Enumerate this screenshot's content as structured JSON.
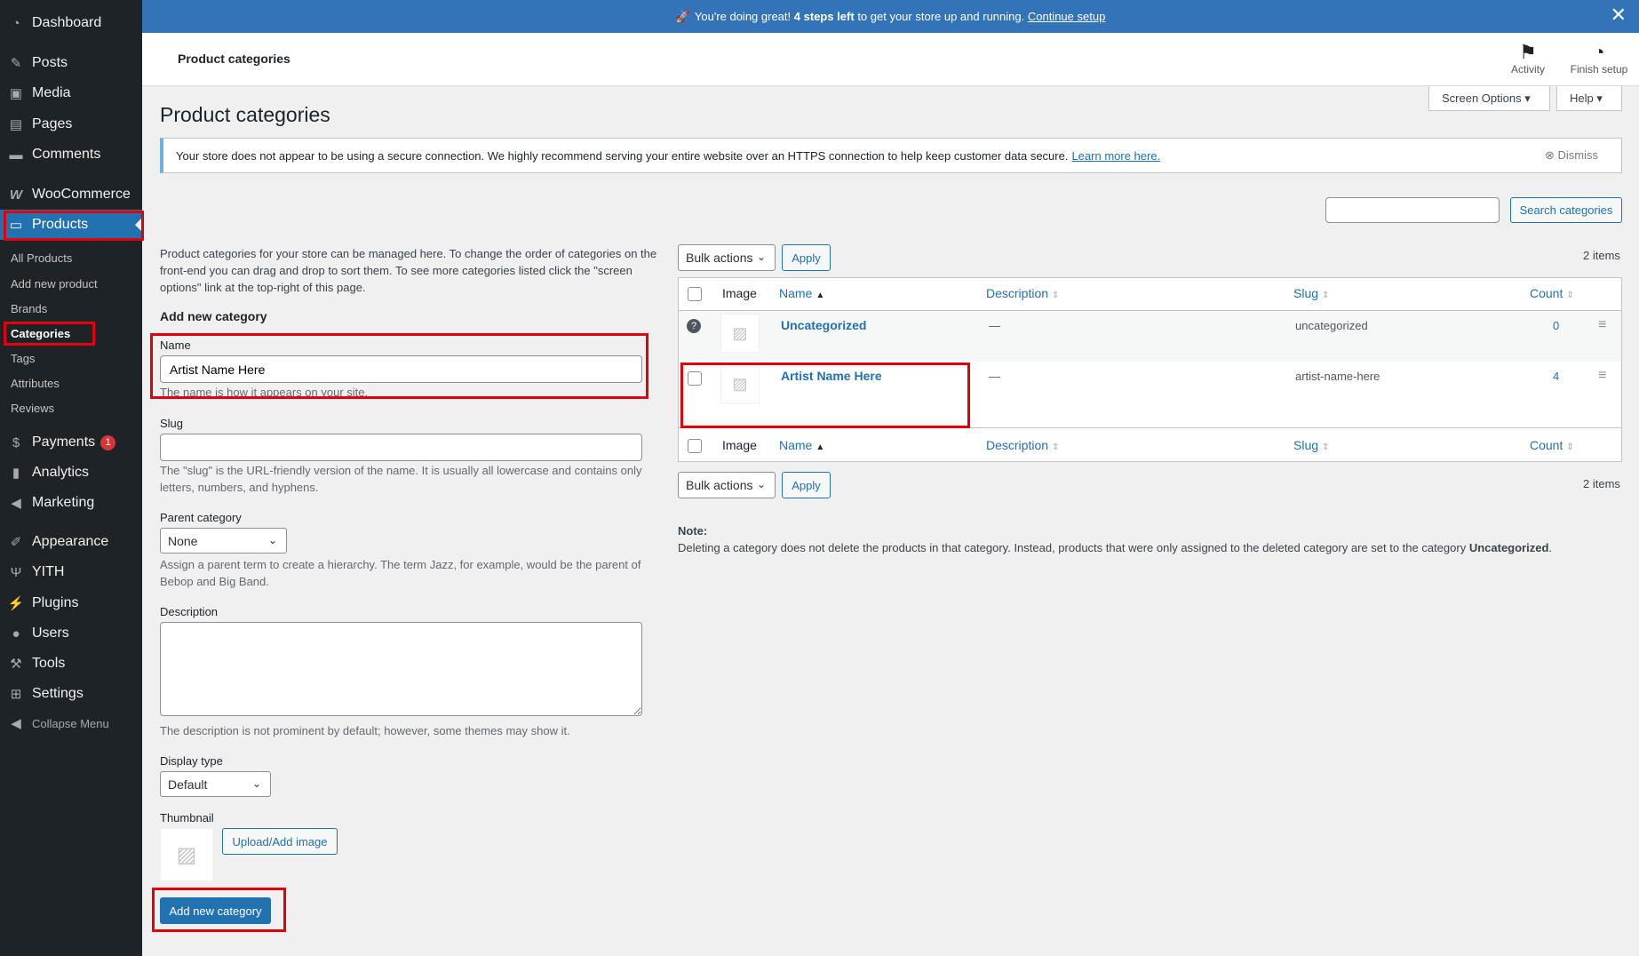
{
  "sidebar": {
    "dashboard": "Dashboard",
    "posts": "Posts",
    "media": "Media",
    "pages": "Pages",
    "comments": "Comments",
    "woocommerce": "WooCommerce",
    "products": "Products",
    "submenu": [
      "All Products",
      "Add new product",
      "Brands",
      "Categories",
      "Tags",
      "Attributes",
      "Reviews"
    ],
    "payments": "Payments",
    "payments_badge": "1",
    "analytics": "Analytics",
    "marketing": "Marketing",
    "appearance": "Appearance",
    "yith": "YITH",
    "plugins": "Plugins",
    "users": "Users",
    "tools": "Tools",
    "settings": "Settings",
    "collapse": "Collapse Menu"
  },
  "banner": {
    "emoji": "🚀",
    "text_start": "You're doing great!",
    "bold": "4 steps left",
    "text_end": "to get your store up and running.",
    "link": "Continue setup"
  },
  "header": {
    "title": "Product categories",
    "activity": "Activity",
    "finish_setup": "Finish setup"
  },
  "screen_options": "Screen Options ▾",
  "help": "Help ▾",
  "page_title": "Product categories",
  "notice": {
    "text": "Your store does not appear to be using a secure connection. We highly recommend serving your entire website over an HTTPS connection to help keep customer data secure.",
    "link": "Learn more here.",
    "dismiss": "Dismiss"
  },
  "search": {
    "button": "Search categories",
    "value": ""
  },
  "form": {
    "intro": "Product categories for your store can be managed here. To change the order of categories on the front-end you can drag and drop to sort them. To see more categories listed click the \"screen options\" link at the top-right of this page.",
    "heading": "Add new category",
    "name_label": "Name",
    "name_value": "Artist Name Here",
    "name_help": "The name is how it appears on your site.",
    "slug_label": "Slug",
    "slug_value": "",
    "slug_help": "The \"slug\" is the URL-friendly version of the name. It is usually all lowercase and contains only letters, numbers, and hyphens.",
    "parent_label": "Parent category",
    "parent_value": "None",
    "parent_help": "Assign a parent term to create a hierarchy. The term Jazz, for example, would be the parent of Bebop and Big Band.",
    "desc_label": "Description",
    "desc_help": "The description is not prominent by default; however, some themes may show it.",
    "display_label": "Display type",
    "display_value": "Default",
    "thumb_label": "Thumbnail",
    "upload": "Upload/Add image",
    "submit": "Add new category"
  },
  "table": {
    "bulk": "Bulk actions",
    "apply": "Apply",
    "items": "2 items",
    "headers": {
      "image": "Image",
      "name": "Name",
      "description": "Description",
      "slug": "Slug",
      "count": "Count"
    },
    "rows": [
      {
        "name": "Uncategorized",
        "description": "—",
        "slug": "uncategorized",
        "count": "0"
      },
      {
        "name": "Artist Name Here",
        "description": "—",
        "slug": "artist-name-here",
        "count": "4"
      }
    ],
    "note_title": "Note:",
    "note_text": "Deleting a category does not delete the products in that category. Instead, products that were only assigned to the deleted category are set to the category",
    "note_bold": "Uncategorized",
    "note_end": "."
  }
}
